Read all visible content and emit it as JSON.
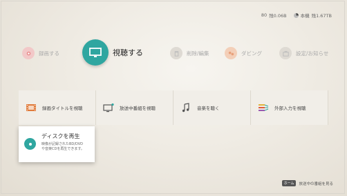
{
  "status": {
    "recording_label": "80",
    "recording_value": "残0.06B",
    "device_label": "本機",
    "device_value": "残1.67TB"
  },
  "menu": {
    "record": "録画する",
    "watch": "視聴する",
    "delete_edit": "削除/編集",
    "dubbing": "ダビング",
    "settings": "設定/お知らせ"
  },
  "tiles": {
    "recorded_titles": "録画タイトルを視聴",
    "broadcast": "放送中番組を視聴",
    "music": "音楽を聴く",
    "external_input": "外部入力を視聴"
  },
  "disc": {
    "title": "ディスクを再生",
    "desc_line1": "映像が記録されたBD/DVD",
    "desc_line2": "や音楽CDを再生できます。"
  },
  "hint": {
    "key": "ホーム",
    "text": "放送中の番組を見る"
  },
  "colors": {
    "accent": "#2fa6a0",
    "record": "#e88a8a",
    "dubbing": "#e8a07a",
    "inactive": "#c0bcb5"
  }
}
